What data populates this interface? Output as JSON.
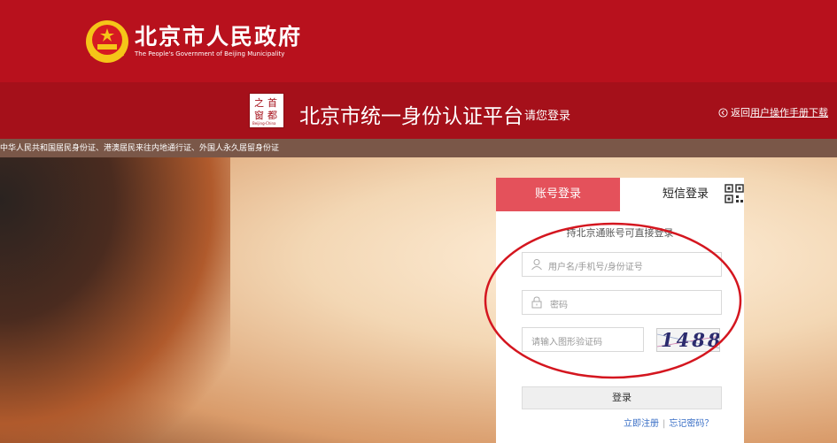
{
  "header": {
    "title": "北京市人民政府",
    "subtitle": "The People's Government of Beijing Municipality"
  },
  "platform": {
    "logo_text": [
      "之",
      "首",
      "窗",
      "都"
    ],
    "logo_caption": "Beijing-China",
    "title": "北京市统一身份认证平台",
    "subtitle": "请您登录",
    "back_label": "返回",
    "manual_label": "用户操作手册下载"
  },
  "notice": {
    "text": "中华人民共和国居民身份证、港澳居民来往内地通行证、外国人永久居留身份证"
  },
  "login": {
    "tab_account": "账号登录",
    "tab_sms": "短信登录",
    "hint": "持北京通账号可直接登录",
    "username_placeholder": "用户名/手机号/身份证号",
    "password_placeholder": "密码",
    "captcha_placeholder": "请输入图形验证码",
    "captcha_code": "1488",
    "submit_label": "登录",
    "register_label": "立即注册",
    "separator": "|",
    "forgot_label": "忘记密码？"
  },
  "colors": {
    "brand_red": "#b8111d",
    "tab_active": "#e4515b",
    "link_blue": "#3a6fc6",
    "annotation_red": "#d4161f"
  },
  "icons": {
    "emblem": "national-emblem-icon",
    "back": "back-arrow-icon",
    "qr": "qr-code-icon",
    "user": "user-icon",
    "lock": "lock-icon"
  }
}
